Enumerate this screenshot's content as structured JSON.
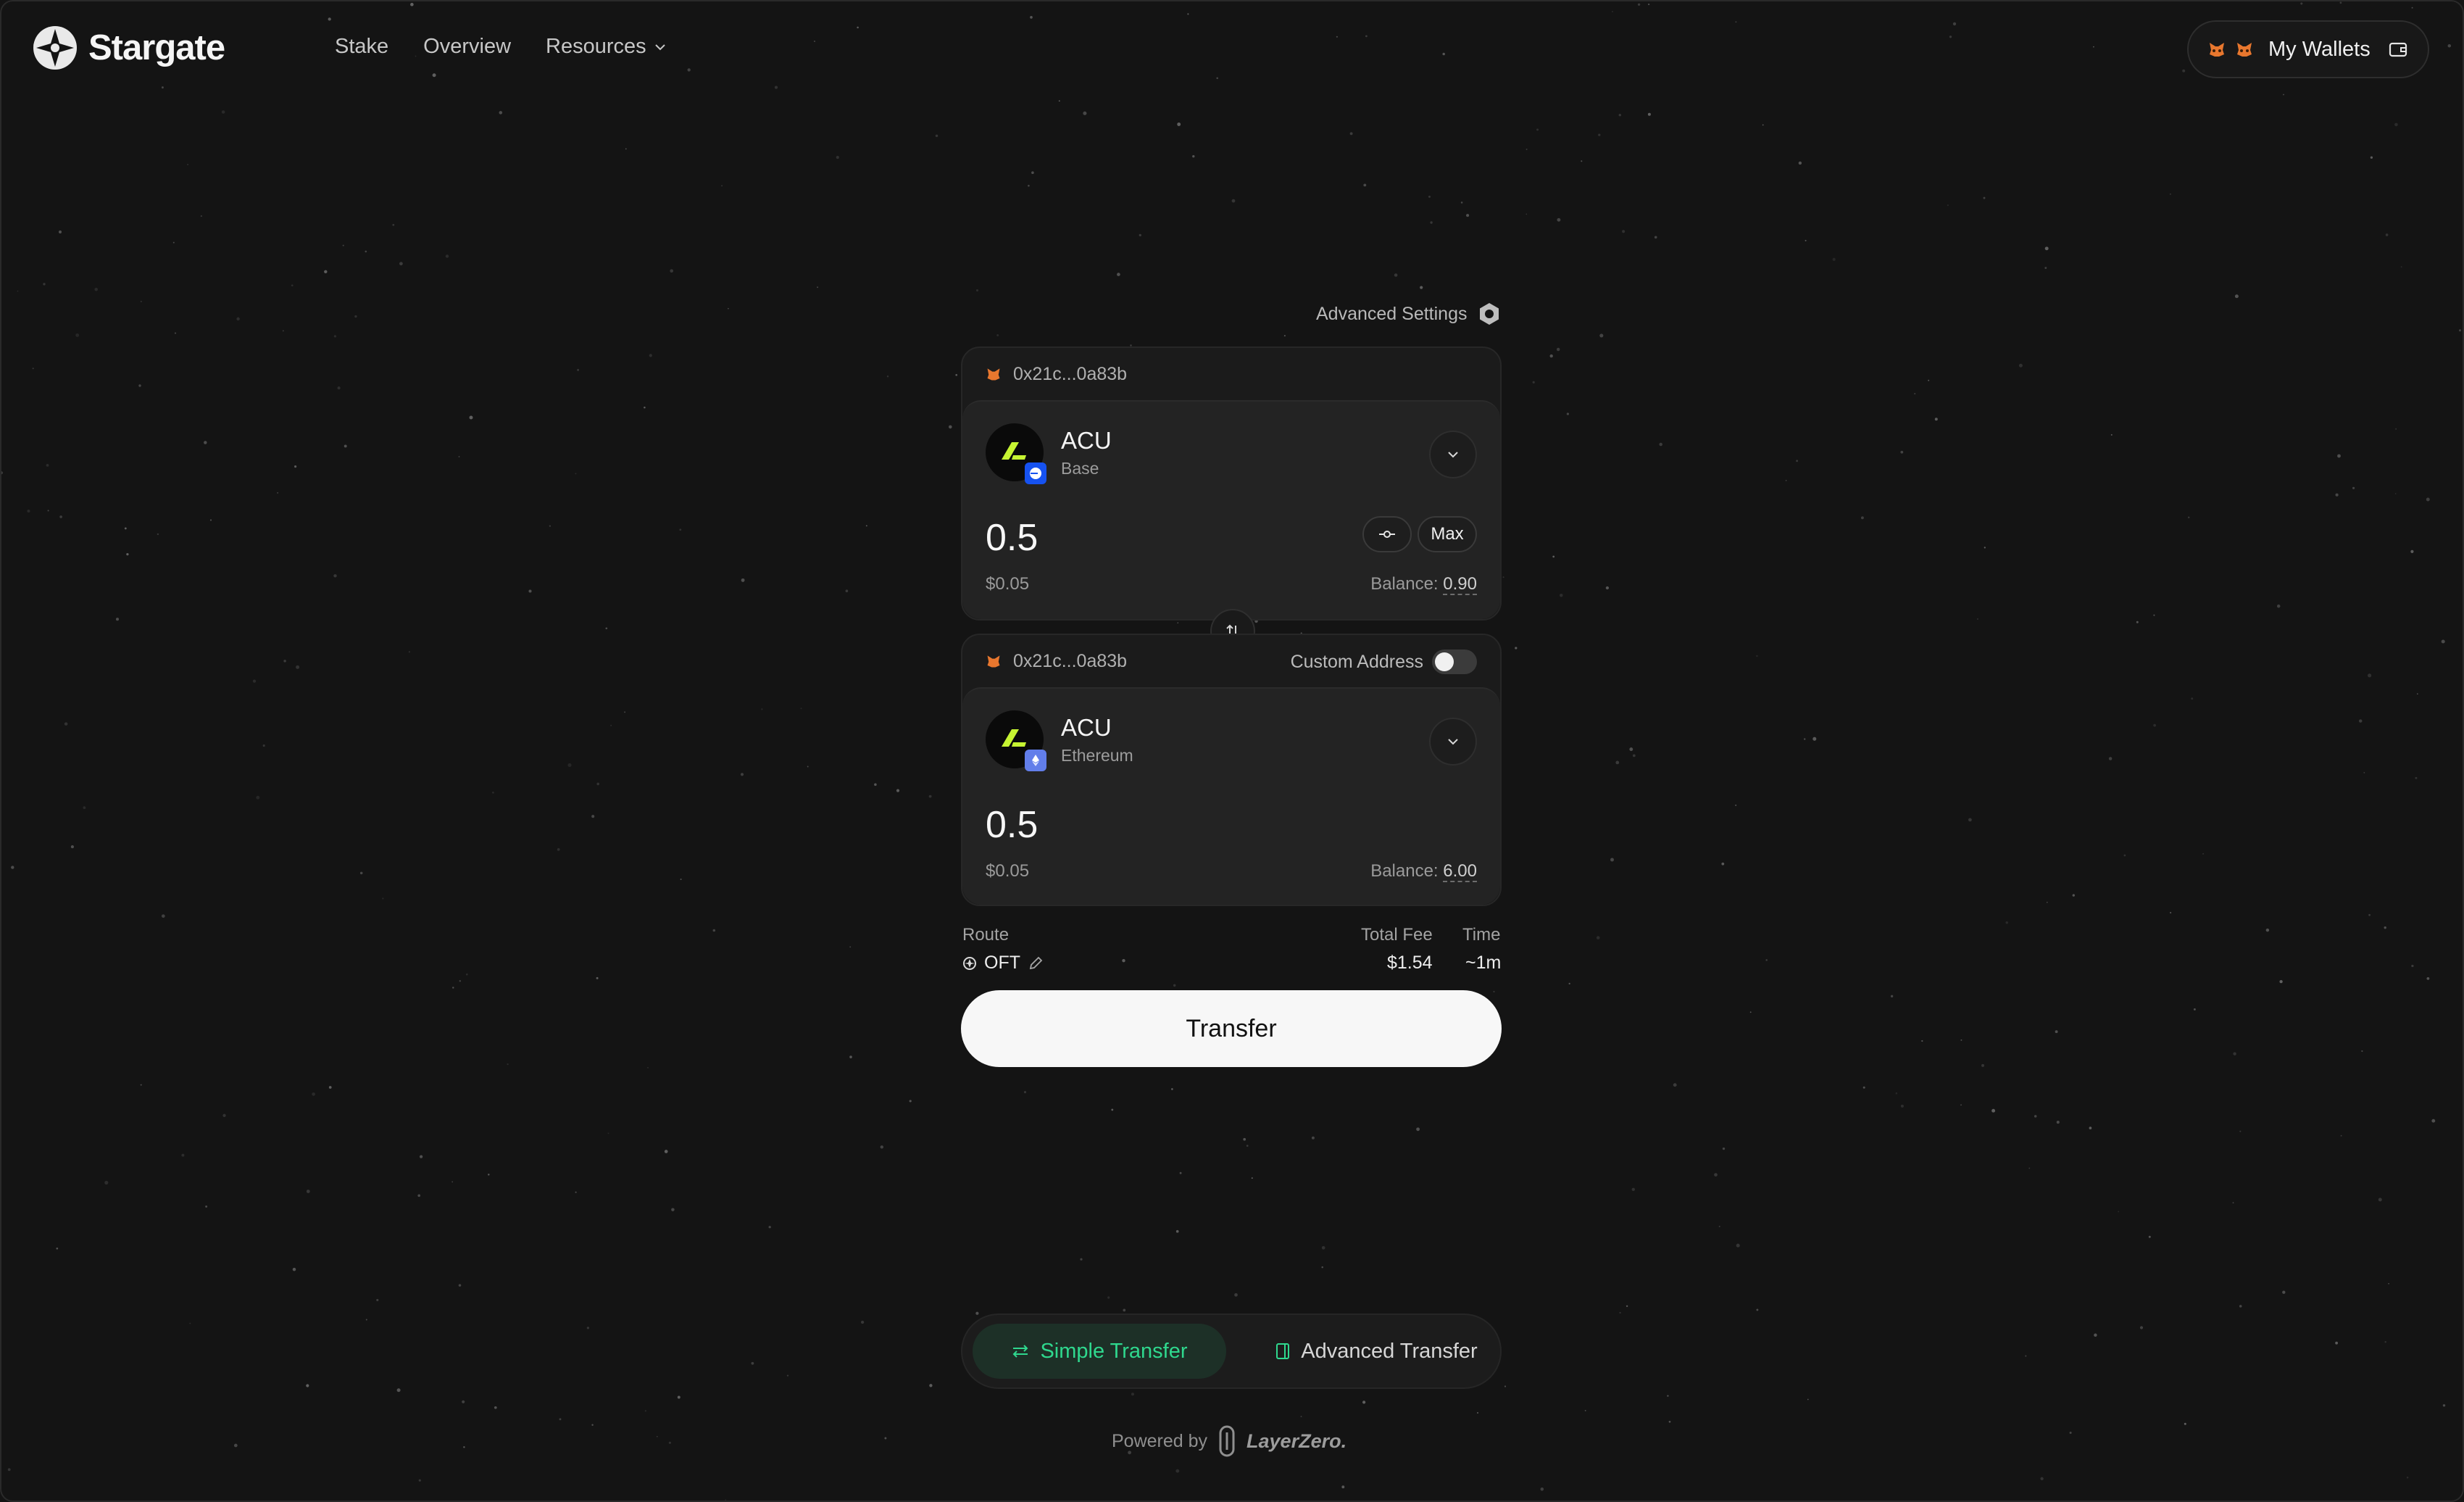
{
  "header": {
    "app_name": "Stargate",
    "nav": [
      "Stake",
      "Overview",
      "Resources"
    ],
    "wallets_label": "My Wallets"
  },
  "advanced_settings_label": "Advanced Settings",
  "from": {
    "wallet_address": "0x21c...0a83b",
    "token": "ACU",
    "chain": "Base",
    "amount": "0.5",
    "usd_value": "$0.05",
    "balance_label": "Balance:",
    "balance_value": "0.90",
    "max_label": "Max"
  },
  "to": {
    "wallet_address": "0x21c...0a83b",
    "custom_address_label": "Custom Address",
    "token": "ACU",
    "chain": "Ethereum",
    "amount": "0.5",
    "usd_value": "$0.05",
    "balance_label": "Balance:",
    "balance_value": "6.00"
  },
  "route": {
    "route_label": "Route",
    "route_value": "OFT",
    "fee_label": "Total Fee",
    "fee_value": "$1.54",
    "time_label": "Time",
    "time_value": "~1m"
  },
  "transfer_label": "Transfer",
  "tabs": {
    "simple": "Simple Transfer",
    "advanced": "Advanced Transfer"
  },
  "footer": {
    "powered_by": "Powered by",
    "brand": "LayerZero."
  },
  "colors": {
    "background": "#141414",
    "accent_green": "#2fd88e",
    "token_lime": "#c6f432",
    "metamask_orange": "#e8772e"
  }
}
